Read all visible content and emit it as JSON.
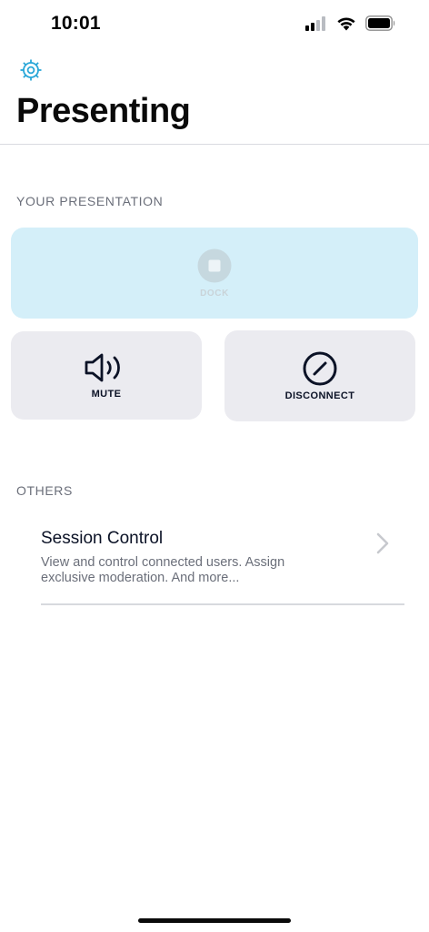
{
  "status_bar": {
    "time": "10:01"
  },
  "colors": {
    "accent": "#2aa7d8",
    "dock_bg": "#d4eff9",
    "card_bg": "#ebebf0",
    "text_primary": "#0b1226",
    "text_secondary": "#6b6f7a"
  },
  "header": {
    "settings_icon": "gear-icon",
    "title": "Presenting"
  },
  "presentation": {
    "heading": "YOUR PRESENTATION",
    "dock": {
      "label": "DOCK",
      "icon": "stop-icon"
    },
    "mute": {
      "label": "MUTE",
      "icon": "speaker-icon"
    },
    "disconnect": {
      "label": "DISCONNECT",
      "icon": "prohibited-icon"
    }
  },
  "others": {
    "heading": "OTHERS",
    "items": [
      {
        "title": "Session Control",
        "description": "View and control connected users. Assign exclusive moderation. And more...",
        "icon": "chevron-right-icon"
      }
    ]
  }
}
